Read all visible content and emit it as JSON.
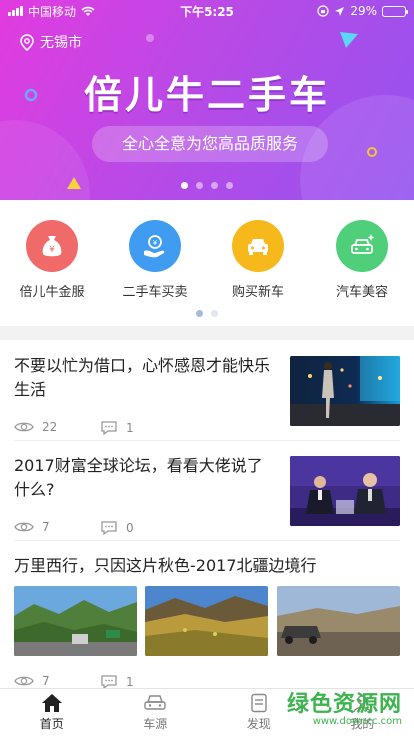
{
  "status": {
    "carrier": "中国移动",
    "time": "下午5:25",
    "battery": "29%",
    "battery_level": 0.29
  },
  "banner": {
    "location": "无锡市",
    "title": "倍儿牛二手车",
    "slogan": "全心全意为您高品质服务",
    "pages": 4,
    "active_page": 0
  },
  "categories": {
    "items": [
      {
        "label": "倍儿牛金服",
        "icon": "money-bag-icon",
        "color": "#f06a6a"
      },
      {
        "label": "二手车买卖",
        "icon": "hand-coin-icon",
        "color": "#3f9cf0"
      },
      {
        "label": "购买新车",
        "icon": "car-icon",
        "color": "#f6b81a"
      },
      {
        "label": "汽车美容",
        "icon": "car-sparkle-icon",
        "color": "#4fcf7a"
      }
    ],
    "pages": 2,
    "active_page": 0
  },
  "feed": {
    "articles": [
      {
        "title": "不要以忙为借口，心怀感恩才能快乐生活",
        "views": "22",
        "comments": "1"
      },
      {
        "title": "2017财富全球论坛，看看大佬说了什么?",
        "views": "7",
        "comments": "0"
      },
      {
        "title": "万里西行，只因这片秋色-2017北疆边境行",
        "views": "7",
        "comments": "1"
      }
    ]
  },
  "tabbar": {
    "items": [
      {
        "label": "首页",
        "icon": "home-icon",
        "active": true
      },
      {
        "label": "车源",
        "icon": "car-outline-icon",
        "active": false
      },
      {
        "label": "发现",
        "icon": "discover-icon",
        "active": false
      },
      {
        "label": "我的",
        "icon": "profile-icon",
        "active": false
      }
    ]
  },
  "watermark": {
    "name": "绿色资源网",
    "url": "www.downcc.com"
  }
}
